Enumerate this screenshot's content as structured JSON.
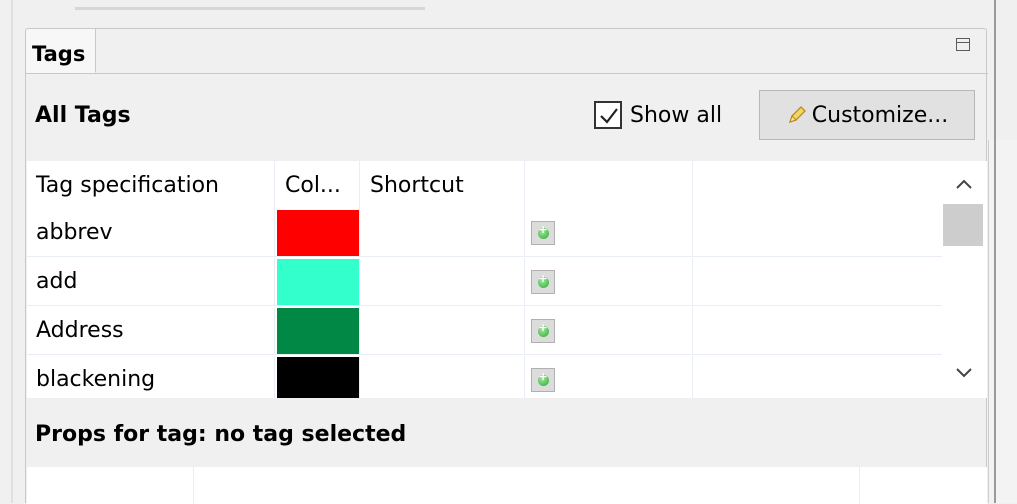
{
  "view": {
    "tab_label": "Tags",
    "section_title": "All Tags",
    "show_all_label": "Show all",
    "show_all_checked": true,
    "customize_label": "Customize...",
    "props_title": "Props for tag: no tag selected"
  },
  "table": {
    "columns": [
      "Tag specification",
      "Col...",
      "Shortcut",
      "",
      ""
    ],
    "rows": [
      {
        "tag": "abbrev",
        "color": "#ff0000",
        "shortcut": ""
      },
      {
        "tag": "add",
        "color": "#33ffcc",
        "shortcut": ""
      },
      {
        "tag": "Address",
        "color": "#008844",
        "shortcut": ""
      },
      {
        "tag": "blackening",
        "color": "#000000",
        "shortcut": ""
      }
    ]
  },
  "icons": {
    "minimize": "minimize-icon",
    "checkbox": "checkmark-icon",
    "customize": "pencil-icon",
    "add": "add-icon",
    "scroll_up": "chevron-up-icon",
    "scroll_down": "chevron-down-icon"
  }
}
